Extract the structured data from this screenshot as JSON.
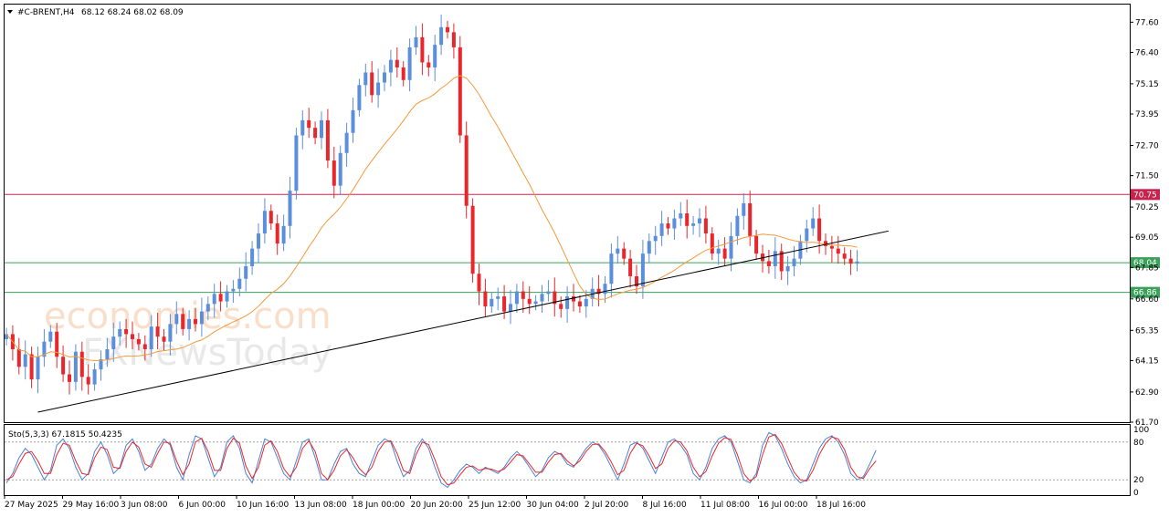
{
  "header": {
    "symbol": "#C-BRENT,H4",
    "ohlc": "68.12 68.24 68.02 68.09"
  },
  "watermark": {
    "line1": "economies.com",
    "line2": "FXNewsToday"
  },
  "colors": {
    "bull": "#5b8fdc",
    "bear": "#e8262b",
    "ma": "#f39a3c",
    "resistance": "#c8234d",
    "support": "#3aa05a",
    "trendline": "#000000",
    "stoch_main": "#4a82d8",
    "stoch_signal": "#e8262b"
  },
  "chart_data": [
    {
      "type": "candlestick",
      "symbol": "#C-BRENT",
      "timeframe": "H4",
      "ylim": [
        61.7,
        78.3
      ],
      "yticks": [
        "77.60",
        "76.40",
        "75.15",
        "73.95",
        "72.70",
        "71.50",
        "70.25",
        "69.05",
        "67.85",
        "66.60",
        "65.35",
        "64.15",
        "62.90",
        "61.70"
      ],
      "xticks": [
        "27 May 2025",
        "29 May 16:00",
        "3 Jun 08:00",
        "6 Jun 00:00",
        "10 Jun 16:00",
        "13 Jun 08:00",
        "18 Jun 00:00",
        "20 Jun 20:00",
        "25 Jun 12:00",
        "30 Jun 04:00",
        "2 Jul 20:00",
        "8 Jul 16:00",
        "11 Jul 08:00",
        "16 Jul 00:00",
        "18 Jul 16:00"
      ],
      "close_path": [
        65.2,
        64.6,
        63.9,
        64.4,
        63.4,
        64.3,
        64.9,
        65.3,
        64.3,
        63.6,
        63.3,
        64.5,
        63.5,
        63.2,
        63.8,
        64.2,
        64.6,
        65.1,
        65.4,
        65.2,
        65.0,
        64.8,
        64.6,
        65.5,
        65.1,
        64.9,
        65.6,
        66.0,
        65.4,
        65.8,
        65.6,
        66.1,
        66.4,
        66.8,
        66.5,
        66.9,
        67.0,
        67.4,
        67.9,
        68.6,
        69.2,
        70.1,
        69.6,
        68.8,
        69.5,
        70.9,
        73.1,
        73.7,
        73.4,
        73.0,
        73.7,
        72.1,
        71.1,
        72.4,
        73.2,
        74.1,
        75.1,
        75.6,
        74.7,
        75.2,
        75.6,
        76.1,
        75.8,
        75.3,
        76.6,
        77.0,
        76.0,
        75.8,
        76.7,
        77.4,
        77.2,
        76.6,
        73.1,
        70.3,
        67.6,
        66.9,
        66.3,
        66.6,
        66.7,
        66.1,
        66.4,
        66.9,
        66.6,
        66.4,
        66.5,
        66.8,
        66.9,
        66.4,
        66.2,
        66.7,
        66.5,
        66.3,
        66.6,
        67.0,
        66.8,
        67.2,
        68.4,
        68.6,
        68.2,
        67.5,
        67.1,
        68.4,
        68.9,
        69.1,
        69.6,
        69.4,
        69.8,
        70.0,
        69.5,
        69.6,
        69.8,
        69.2,
        68.4,
        68.6,
        68.2,
        69.1,
        69.9,
        70.4,
        69.1,
        68.4,
        68.1,
        67.9,
        68.5,
        67.7,
        67.9,
        68.2,
        68.9,
        69.4,
        69.8,
        68.9,
        68.7,
        68.6,
        68.4,
        68.2,
        68.0,
        68.09
      ],
      "annotations": [
        {
          "label": "70.75",
          "value": 70.75,
          "kind": "horizontal line"
        },
        {
          "label": "68.04",
          "value": 68.04,
          "kind": "horizontal line"
        },
        {
          "label": "66.86",
          "value": 66.86,
          "kind": "horizontal line"
        }
      ],
      "trendline": {
        "from": [
          5,
          62.1
        ],
        "to": [
          140,
          69.3
        ]
      },
      "moving_average": true,
      "grid": false
    },
    {
      "type": "line",
      "title": "Sto(5,3,3) 67.1815 50.4235",
      "ylim": [
        0,
        100
      ],
      "yticks": [
        "100",
        "80",
        "20",
        "0"
      ],
      "levels": [
        80,
        20
      ],
      "series": [
        {
          "values": [
            15,
            30,
            55,
            70,
            60,
            40,
            20,
            35,
            75,
            85,
            70,
            40,
            20,
            30,
            65,
            80,
            60,
            30,
            40,
            75,
            85,
            65,
            35,
            45,
            70,
            85,
            75,
            40,
            20,
            60,
            90,
            85,
            55,
            25,
            40,
            80,
            90,
            70,
            30,
            15,
            50,
            85,
            80,
            55,
            30,
            20,
            50,
            80,
            85,
            55,
            20,
            20,
            45,
            65,
            70,
            45,
            30,
            25,
            50,
            75,
            85,
            80,
            50,
            25,
            35,
            70,
            85,
            70,
            40,
            15,
            8,
            20,
            35,
            45,
            40,
            30,
            40,
            35,
            30,
            40,
            55,
            65,
            55,
            40,
            25,
            35,
            55,
            65,
            60,
            45,
            40,
            55,
            70,
            80,
            75,
            60,
            40,
            20,
            45,
            75,
            80,
            70,
            50,
            30,
            55,
            80,
            85,
            75,
            60,
            30,
            20,
            40,
            70,
            85,
            90,
            80,
            50,
            20,
            15,
            30,
            75,
            95,
            90,
            70,
            45,
            25,
            15,
            20,
            45,
            70,
            85,
            90,
            80,
            60,
            30,
            20,
            25,
            45,
            67
          ]
        },
        {
          "values": [
            20,
            25,
            45,
            62,
            65,
            50,
            30,
            30,
            60,
            78,
            75,
            50,
            30,
            28,
            55,
            72,
            68,
            40,
            38,
            65,
            80,
            72,
            45,
            40,
            62,
            80,
            78,
            50,
            28,
            45,
            80,
            86,
            65,
            35,
            35,
            70,
            86,
            78,
            42,
            22,
            40,
            75,
            82,
            65,
            38,
            25,
            40,
            70,
            82,
            65,
            30,
            20,
            35,
            58,
            68,
            55,
            38,
            28,
            40,
            65,
            80,
            82,
            62,
            35,
            30,
            60,
            80,
            76,
            52,
            25,
            12,
            15,
            28,
            40,
            42,
            35,
            38,
            37,
            33,
            37,
            48,
            60,
            58,
            45,
            32,
            32,
            48,
            60,
            62,
            50,
            42,
            50,
            65,
            76,
            77,
            65,
            48,
            28,
            35,
            62,
            78,
            74,
            58,
            38,
            45,
            70,
            82,
            80,
            66,
            40,
            25,
            33,
            58,
            78,
            87,
            84,
            60,
            30,
            18,
            25,
            60,
            88,
            92,
            78,
            55,
            32,
            20,
            18,
            35,
            60,
            78,
            88,
            85,
            68,
            40,
            25,
            22,
            38,
            50
          ]
        }
      ]
    }
  ]
}
